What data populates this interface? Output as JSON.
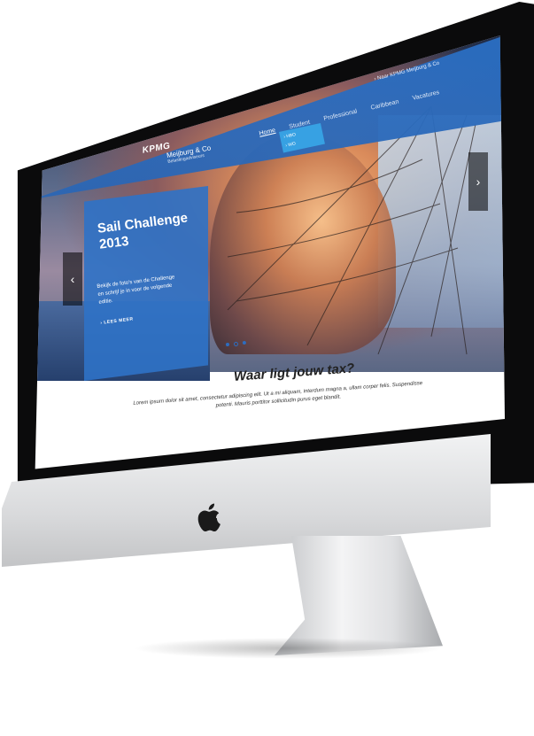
{
  "site": {
    "brand_logo": "KPMG",
    "brand_name": "Meijburg & Co",
    "brand_sub": "Belastingadviseurs",
    "external_link": "Naar KPMG Meijburg & Co",
    "nav": [
      {
        "label": "Home",
        "active": true
      },
      {
        "label": "Student",
        "active": false
      },
      {
        "label": "Professional",
        "active": false
      },
      {
        "label": "Caribbean",
        "active": false
      },
      {
        "label": "Vacatures",
        "active": false
      }
    ],
    "dropdown": [
      "HBO",
      "WO"
    ]
  },
  "hero": {
    "title": "Sail Challenge 2013",
    "text": "Bekijk de foto's van de Challenge en schrijf je in voor de volgende editie.",
    "link": "LEES MEER",
    "slides_total": 3,
    "slide_active": 2
  },
  "main": {
    "heading": "Waar ligt jouw tax?",
    "text": "Lorem ipsum dolor sit amet, consectetur adipiscing elit. Ut a mi aliquam, interdum magna a, ullam corper felis. Suspendisse potenti. Mauris porttitor sollicitudin purus eget blandit."
  },
  "colors": {
    "primary": "#2a6fc4",
    "accent": "#37a1e3"
  },
  "icons": {
    "arrow_left": "chevron-left-icon",
    "arrow_right": "chevron-right-icon",
    "hardware_logo": "apple-logo-icon"
  }
}
